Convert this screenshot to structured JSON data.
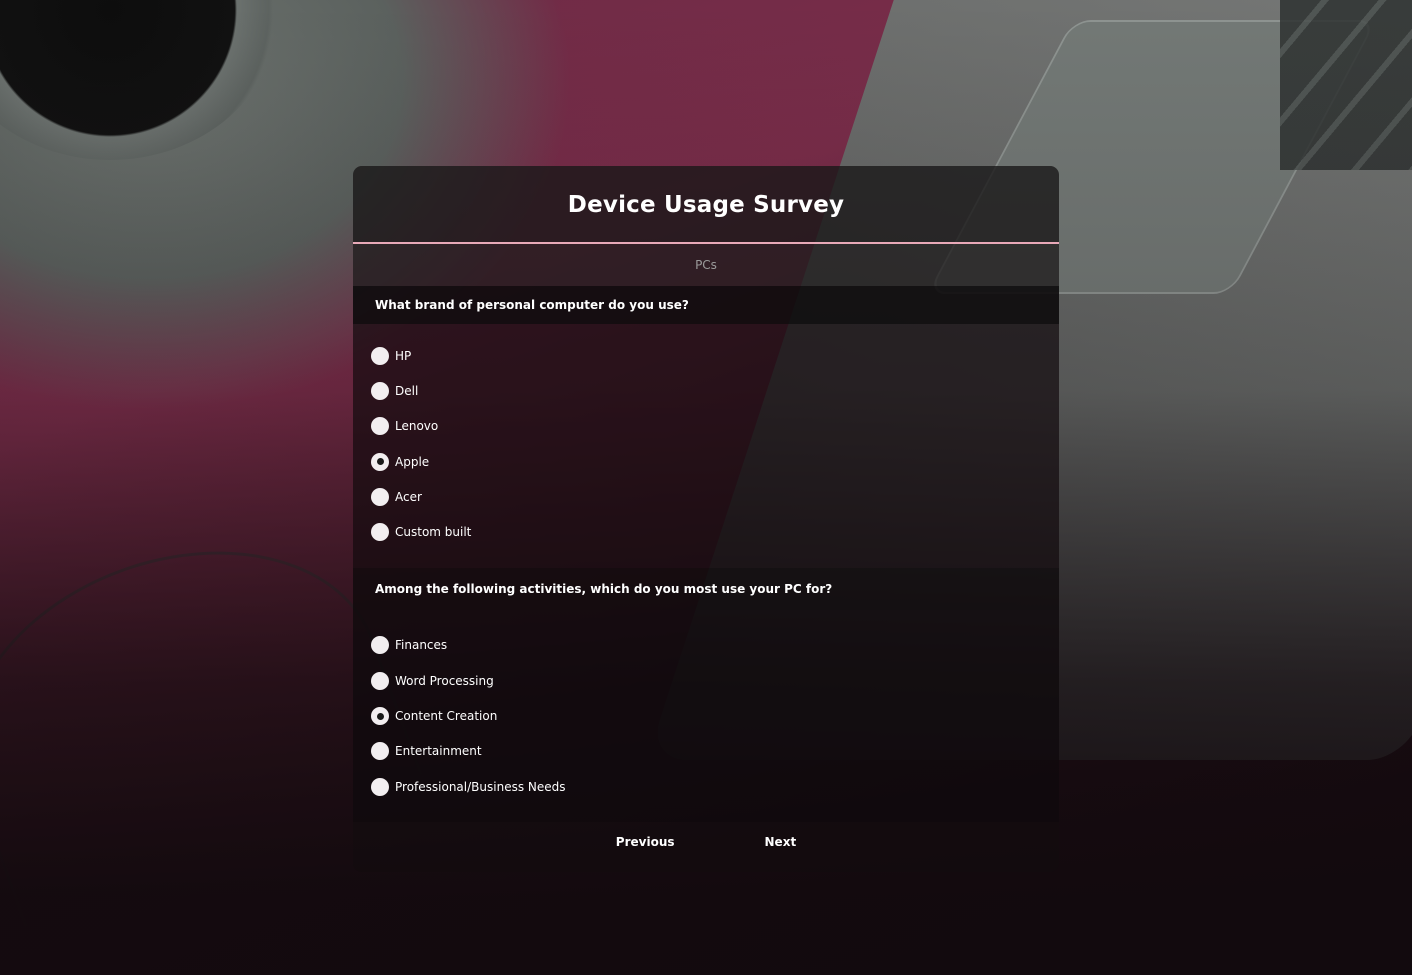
{
  "survey": {
    "title": "Device Usage Survey",
    "section": "PCs",
    "accent_color": "#e8a9b8"
  },
  "questions": [
    {
      "text": "What brand of personal computer do you use?",
      "options": [
        {
          "label": "HP",
          "selected": false
        },
        {
          "label": "Dell",
          "selected": false
        },
        {
          "label": "Lenovo",
          "selected": false
        },
        {
          "label": "Apple",
          "selected": true
        },
        {
          "label": "Acer",
          "selected": false
        },
        {
          "label": "Custom built",
          "selected": false
        }
      ]
    },
    {
      "text": "Among the following activities, which do you most use your PC for?",
      "options": [
        {
          "label": "Finances",
          "selected": false
        },
        {
          "label": "Word Processing",
          "selected": false
        },
        {
          "label": "Content Creation",
          "selected": true
        },
        {
          "label": "Entertainment",
          "selected": false
        },
        {
          "label": "Professional/Business Needs",
          "selected": false
        }
      ]
    }
  ],
  "navigation": {
    "previous_label": "Previous",
    "next_label": "Next"
  }
}
